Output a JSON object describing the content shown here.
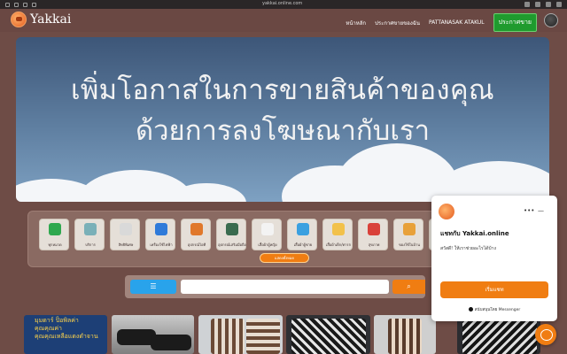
{
  "browser": {
    "url": "yakkai.online.com"
  },
  "header": {
    "brand": "Yakkai",
    "nav": [
      "หน้าหลัก",
      "ประกาศขายของฉัน",
      "PATTANASAK ATAKUL"
    ],
    "cta": "ประกาศขาย"
  },
  "hero": {
    "line1": "เพิ่มโอกาสในการขายสินค้าของคุณ",
    "line2": "ด้วยการลงโฆษณากับเรา"
  },
  "categories": [
    {
      "label": "ทุกหมวด",
      "icon": "checkbox-icon",
      "color": "#2fa84f"
    },
    {
      "label": "บริการ",
      "icon": "services-icon",
      "color": "#7ab0b8"
    },
    {
      "label": "สิทธิพิเศษ",
      "icon": "clipboard-icon",
      "color": "#d9d9d9"
    },
    {
      "label": "เครื่องใช้ไฟฟ้า",
      "icon": "appliance-icon",
      "color": "#2f7ad9"
    },
    {
      "label": "อุปกรณ์ไอที",
      "icon": "computer-icon",
      "color": "#e0782b"
    },
    {
      "label": "อุปกรณ์เสริมมือถือ",
      "icon": "phone-accessory-icon",
      "color": "#3a6b4f"
    },
    {
      "label": "เสื้อผ้าผู้หญิง",
      "icon": "dress-icon",
      "color": "#f3f3f3"
    },
    {
      "label": "เสื้อผ้าผู้ชาย",
      "icon": "shirt-icon",
      "color": "#3aa0e0"
    },
    {
      "label": "เสื้อผ้าเด็ก/ทารก",
      "icon": "kids-clothes-icon",
      "color": "#f2c14a"
    },
    {
      "label": "สุขภาพ",
      "icon": "health-icon",
      "color": "#d9413a"
    },
    {
      "label": "ของใช้ในบ้าน",
      "icon": "home-goods-icon",
      "color": "#e8a13a"
    },
    {
      "label": "อุปกรณ์กีฬา",
      "icon": "sports-icon",
      "color": "#5a4e9a"
    }
  ],
  "more_button": "แสดงทั้งหมด",
  "search": {
    "filter_icon": "list-icon",
    "placeholder": "",
    "go_icon": "search-icon"
  },
  "products": [
    {
      "caption": "มุมดาร์ ป็อพิลค่า\nคุณคุณค่า\nคุณคุณเหลือแดงดำจาน"
    }
  ],
  "chat": {
    "title": "แชทกับ Yakkai.online",
    "greeting": "สวัสดี! ให้เราช่วยอะไรได้บ้าง",
    "start": "เริ่มแชท",
    "powered": "สนับสนุนโดย Messenger"
  },
  "colors": {
    "background": "#6e4c46",
    "accent": "#f07d12",
    "cta": "#1f9b2e",
    "filter": "#29a3eb"
  }
}
